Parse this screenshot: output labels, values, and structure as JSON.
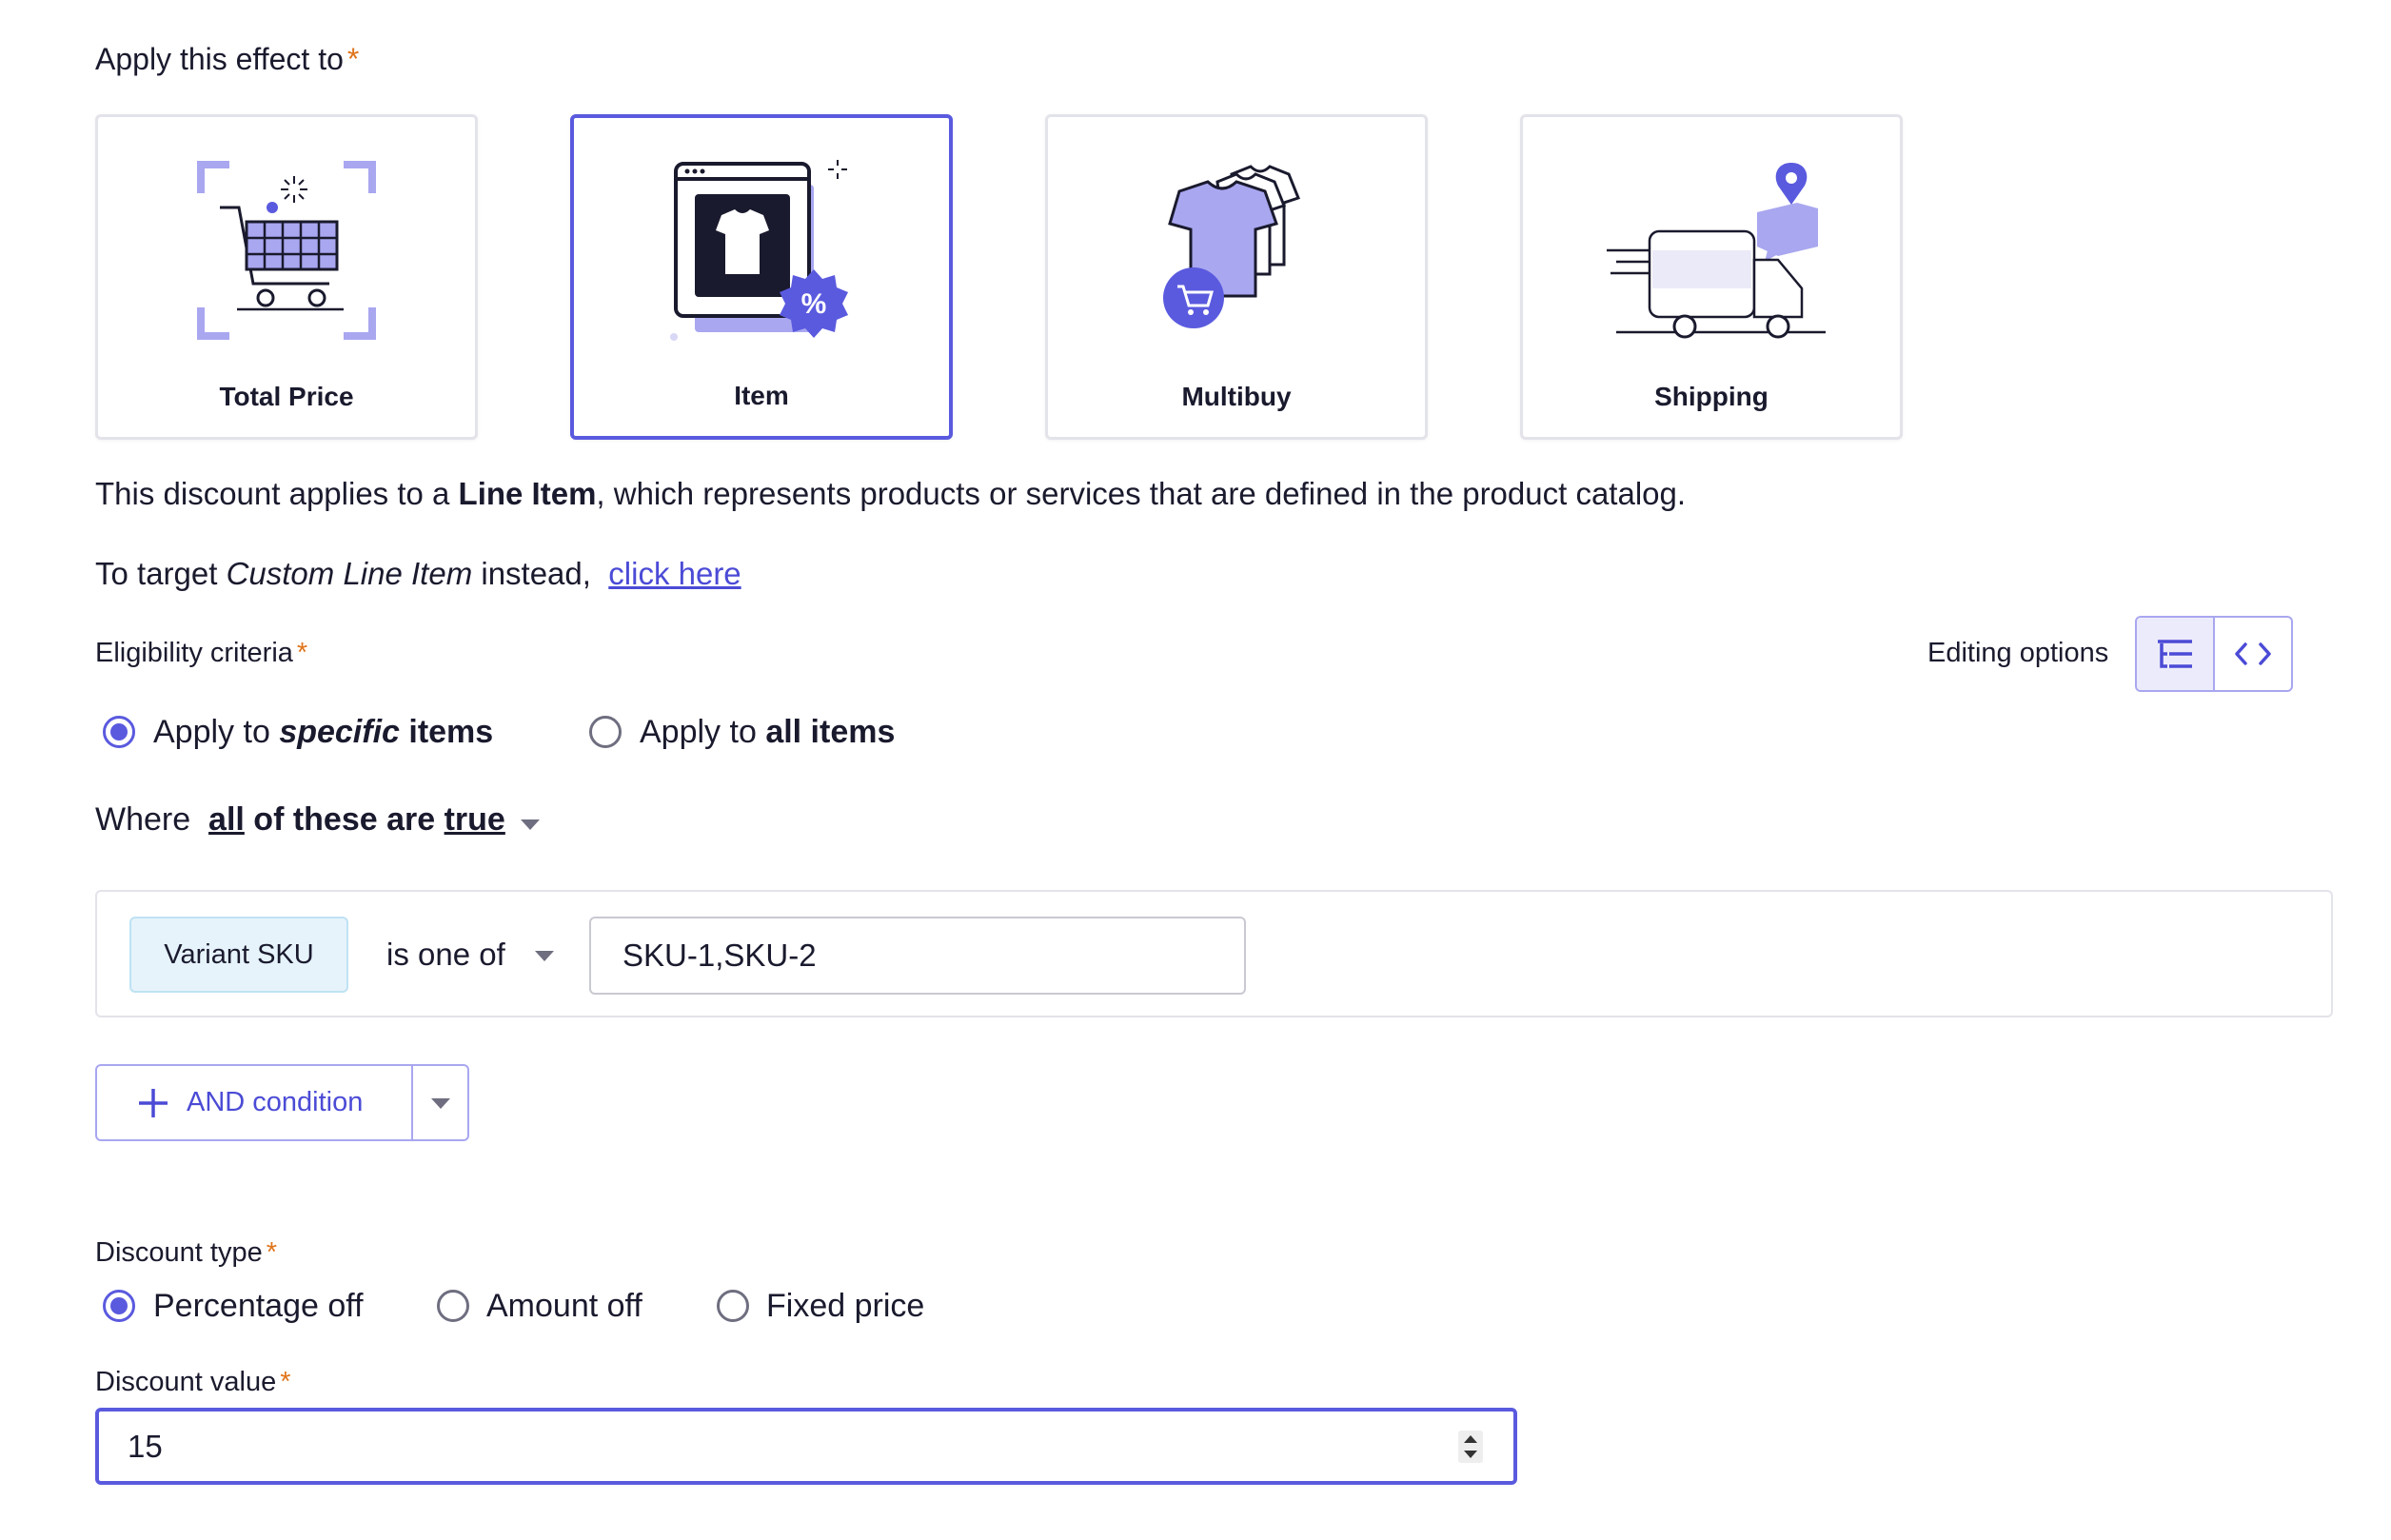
{
  "apply_effect": {
    "label": "Apply this effect to",
    "required_mark": "*",
    "options": [
      {
        "label": "Total Price",
        "selected": false,
        "icon": "shopping-cart-icon"
      },
      {
        "label": "Item",
        "selected": true,
        "icon": "tshirt-percent-icon"
      },
      {
        "label": "Multibuy",
        "selected": false,
        "icon": "shirts-stack-icon"
      },
      {
        "label": "Shipping",
        "selected": false,
        "icon": "delivery-truck-icon"
      }
    ]
  },
  "description": {
    "prefix": "This discount applies to a ",
    "bold": "Line Item",
    "suffix": ", which represents products or services that are defined in the product catalog."
  },
  "custom_target": {
    "prefix": "To target ",
    "italic": "Custom Line Item",
    "suffix": " instead,",
    "link": "click here"
  },
  "eligibility": {
    "label": "Eligibility criteria",
    "required_mark": "*",
    "editing_options_label": "Editing options",
    "editing_modes": [
      {
        "icon": "list-tree-icon",
        "active": true
      },
      {
        "icon": "code-icon",
        "active": false
      }
    ],
    "scope_options": [
      {
        "prefix": "Apply to ",
        "emph": "specific",
        "bold": " items",
        "selected": true
      },
      {
        "prefix": "Apply to ",
        "emph": "",
        "bold": "all items",
        "selected": false
      }
    ],
    "where": {
      "label": "Where",
      "all": "all",
      "middle": " of these are ",
      "true": "true"
    },
    "condition": {
      "field": "Variant SKU",
      "operator": "is one of",
      "value": "SKU-1,SKU-2"
    },
    "add_condition_label": "AND condition"
  },
  "discount_type": {
    "label": "Discount type",
    "required_mark": "*",
    "options": [
      {
        "label": "Percentage off",
        "selected": true
      },
      {
        "label": "Amount off",
        "selected": false
      },
      {
        "label": "Fixed price",
        "selected": false
      }
    ]
  },
  "discount_value": {
    "label": "Discount value",
    "required_mark": "*",
    "value": "15"
  },
  "colors": {
    "accent": "#5a5adf",
    "required": "#e0751a",
    "chip_bg": "#e6f3fb",
    "icon_fill": "#a9a7f0"
  }
}
